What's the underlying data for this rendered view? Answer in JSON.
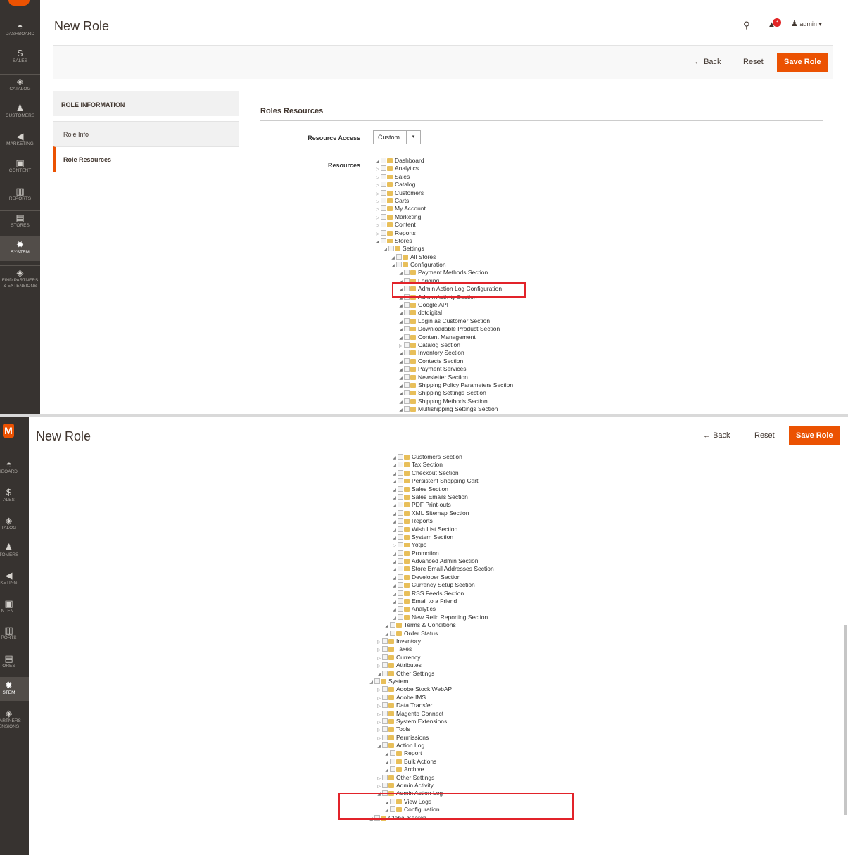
{
  "page": {
    "title": "New Role"
  },
  "sidebar": [
    {
      "id": "dashboard",
      "label": "DASHBOARD",
      "icon": "dashboard-icon"
    },
    {
      "id": "sales",
      "label": "SALES",
      "icon": "dollar-icon"
    },
    {
      "id": "catalog",
      "label": "CATALOG",
      "icon": "cube-icon"
    },
    {
      "id": "customers",
      "label": "CUSTOMERS",
      "icon": "person-icon"
    },
    {
      "id": "marketing",
      "label": "MARKETING",
      "icon": "megaphone-icon"
    },
    {
      "id": "content",
      "label": "CONTENT",
      "icon": "layout-icon"
    },
    {
      "id": "reports",
      "label": "REPORTS",
      "icon": "bar-chart-icon"
    },
    {
      "id": "stores",
      "label": "STORES",
      "icon": "storefront-icon"
    },
    {
      "id": "system",
      "label": "SYSTEM",
      "icon": "gear-icon",
      "active": true
    },
    {
      "id": "partners",
      "label": "FIND PARTNERS & EXTENSIONS",
      "icon": "box-icon"
    }
  ],
  "sidebar_clipped": [
    {
      "label": "IBOARD"
    },
    {
      "label": "ALES"
    },
    {
      "label": "TALOG"
    },
    {
      "label": "TOMERS"
    },
    {
      "label": "KETING"
    },
    {
      "label": "NTENT"
    },
    {
      "label": "PORTS"
    },
    {
      "label": "ORES"
    },
    {
      "label": "STEM",
      "active": true
    },
    {
      "label": "PARTNERS ENSIONS"
    }
  ],
  "header": {
    "user": "admin",
    "notifications": "3"
  },
  "actions": {
    "back": "Back",
    "reset": "Reset",
    "save": "Save Role"
  },
  "tabs": {
    "heading": "ROLE INFORMATION",
    "role_info": "Role Info",
    "role_resources": "Role Resources"
  },
  "resources": {
    "section_title": "Roles Resources",
    "access_label": "Resource Access",
    "access_value": "Custom",
    "resources_label": "Resources"
  },
  "tree_top": [
    {
      "d": 0,
      "t": "Dashboard",
      "e": "open"
    },
    {
      "d": 0,
      "t": "Analytics",
      "e": "closed"
    },
    {
      "d": 0,
      "t": "Sales",
      "e": "closed"
    },
    {
      "d": 0,
      "t": "Catalog",
      "e": "closed"
    },
    {
      "d": 0,
      "t": "Customers",
      "e": "closed"
    },
    {
      "d": 0,
      "t": "Carts",
      "e": "closed"
    },
    {
      "d": 0,
      "t": "My Account",
      "e": "closed"
    },
    {
      "d": 0,
      "t": "Marketing",
      "e": "closed"
    },
    {
      "d": 0,
      "t": "Content",
      "e": "closed"
    },
    {
      "d": 0,
      "t": "Reports",
      "e": "closed"
    },
    {
      "d": 0,
      "t": "Stores",
      "e": "open"
    },
    {
      "d": 1,
      "t": "Settings",
      "e": "open"
    },
    {
      "d": 2,
      "t": "All Stores",
      "e": "open"
    },
    {
      "d": 2,
      "t": "Configuration",
      "e": "open"
    },
    {
      "d": 3,
      "t": "Payment Methods Section",
      "e": "open"
    },
    {
      "d": 3,
      "t": "Logging",
      "e": "open"
    },
    {
      "d": 3,
      "t": "Admin Action Log Configuration",
      "e": "open"
    },
    {
      "d": 3,
      "t": "Admin Activity Section",
      "e": "open"
    },
    {
      "d": 3,
      "t": "Google API",
      "e": "open"
    },
    {
      "d": 3,
      "t": "dotdigital",
      "e": "open"
    },
    {
      "d": 3,
      "t": "Login as Customer Section",
      "e": "open"
    },
    {
      "d": 3,
      "t": "Downloadable Product Section",
      "e": "open"
    },
    {
      "d": 3,
      "t": "Content Management",
      "e": "open"
    },
    {
      "d": 3,
      "t": "Catalog Section",
      "e": "closed"
    },
    {
      "d": 3,
      "t": "Inventory Section",
      "e": "open"
    },
    {
      "d": 3,
      "t": "Contacts Section",
      "e": "open"
    },
    {
      "d": 3,
      "t": "Payment Services",
      "e": "open"
    },
    {
      "d": 3,
      "t": "Newsletter Section",
      "e": "open"
    },
    {
      "d": 3,
      "t": "Shipping Policy Parameters Section",
      "e": "open"
    },
    {
      "d": 3,
      "t": "Shipping Settings Section",
      "e": "open"
    },
    {
      "d": 3,
      "t": "Shipping Methods Section",
      "e": "open"
    },
    {
      "d": 3,
      "t": "Multishipping Settings Section",
      "e": "open"
    }
  ],
  "tree_bottom": [
    {
      "d": 3,
      "t": "Customers Section",
      "e": "open"
    },
    {
      "d": 3,
      "t": "Tax Section",
      "e": "open"
    },
    {
      "d": 3,
      "t": "Checkout Section",
      "e": "open"
    },
    {
      "d": 3,
      "t": "Persistent Shopping Cart",
      "e": "open"
    },
    {
      "d": 3,
      "t": "Sales Section",
      "e": "open"
    },
    {
      "d": 3,
      "t": "Sales Emails Section",
      "e": "open"
    },
    {
      "d": 3,
      "t": "PDF Print-outs",
      "e": "open"
    },
    {
      "d": 3,
      "t": "XML Sitemap Section",
      "e": "open"
    },
    {
      "d": 3,
      "t": "Reports",
      "e": "open"
    },
    {
      "d": 3,
      "t": "Wish List Section",
      "e": "open"
    },
    {
      "d": 3,
      "t": "System Section",
      "e": "open"
    },
    {
      "d": 3,
      "t": "Yotpo",
      "e": "closed"
    },
    {
      "d": 3,
      "t": "Promotion",
      "e": "open"
    },
    {
      "d": 3,
      "t": "Advanced Admin Section",
      "e": "open"
    },
    {
      "d": 3,
      "t": "Store Email Addresses Section",
      "e": "open"
    },
    {
      "d": 3,
      "t": "Developer Section",
      "e": "open"
    },
    {
      "d": 3,
      "t": "Currency Setup Section",
      "e": "open"
    },
    {
      "d": 3,
      "t": "RSS Feeds Section",
      "e": "open"
    },
    {
      "d": 3,
      "t": "Email to a Friend",
      "e": "open"
    },
    {
      "d": 3,
      "t": "Analytics",
      "e": "open"
    },
    {
      "d": 3,
      "t": "New Relic Reporting Section",
      "e": "open"
    },
    {
      "d": 2,
      "t": "Terms & Conditions",
      "e": "open"
    },
    {
      "d": 2,
      "t": "Order Status",
      "e": "open"
    },
    {
      "d": 1,
      "t": "Inventory",
      "e": "closed"
    },
    {
      "d": 1,
      "t": "Taxes",
      "e": "closed"
    },
    {
      "d": 1,
      "t": "Currency",
      "e": "closed"
    },
    {
      "d": 1,
      "t": "Attributes",
      "e": "closed"
    },
    {
      "d": 1,
      "t": "Other Settings",
      "e": "open"
    },
    {
      "d": 0,
      "t": "System",
      "e": "open"
    },
    {
      "d": 1,
      "t": "Adobe Stock WebAPI",
      "e": "closed"
    },
    {
      "d": 1,
      "t": "Adobe IMS",
      "e": "closed"
    },
    {
      "d": 1,
      "t": "Data Transfer",
      "e": "closed"
    },
    {
      "d": 1,
      "t": "Magento Connect",
      "e": "closed"
    },
    {
      "d": 1,
      "t": "System Extensions",
      "e": "closed"
    },
    {
      "d": 1,
      "t": "Tools",
      "e": "closed"
    },
    {
      "d": 1,
      "t": "Permissions",
      "e": "closed"
    },
    {
      "d": 1,
      "t": "Action Log",
      "e": "open"
    },
    {
      "d": 2,
      "t": "Report",
      "e": "open"
    },
    {
      "d": 2,
      "t": "Bulk Actions",
      "e": "open"
    },
    {
      "d": 2,
      "t": "Archive",
      "e": "open"
    },
    {
      "d": 1,
      "t": "Other Settings",
      "e": "closed"
    },
    {
      "d": 1,
      "t": "Admin Activity",
      "e": "closed"
    },
    {
      "d": 1,
      "t": "Admin Action Log",
      "e": "open"
    },
    {
      "d": 2,
      "t": "View Logs",
      "e": "open"
    },
    {
      "d": 2,
      "t": "Configuration",
      "e": "open"
    },
    {
      "d": 0,
      "t": "Global Search",
      "e": "open"
    }
  ],
  "glyphs": {
    "back_arrow": "←",
    "open": "◢",
    "closed": "▷",
    "caret": "▾"
  }
}
